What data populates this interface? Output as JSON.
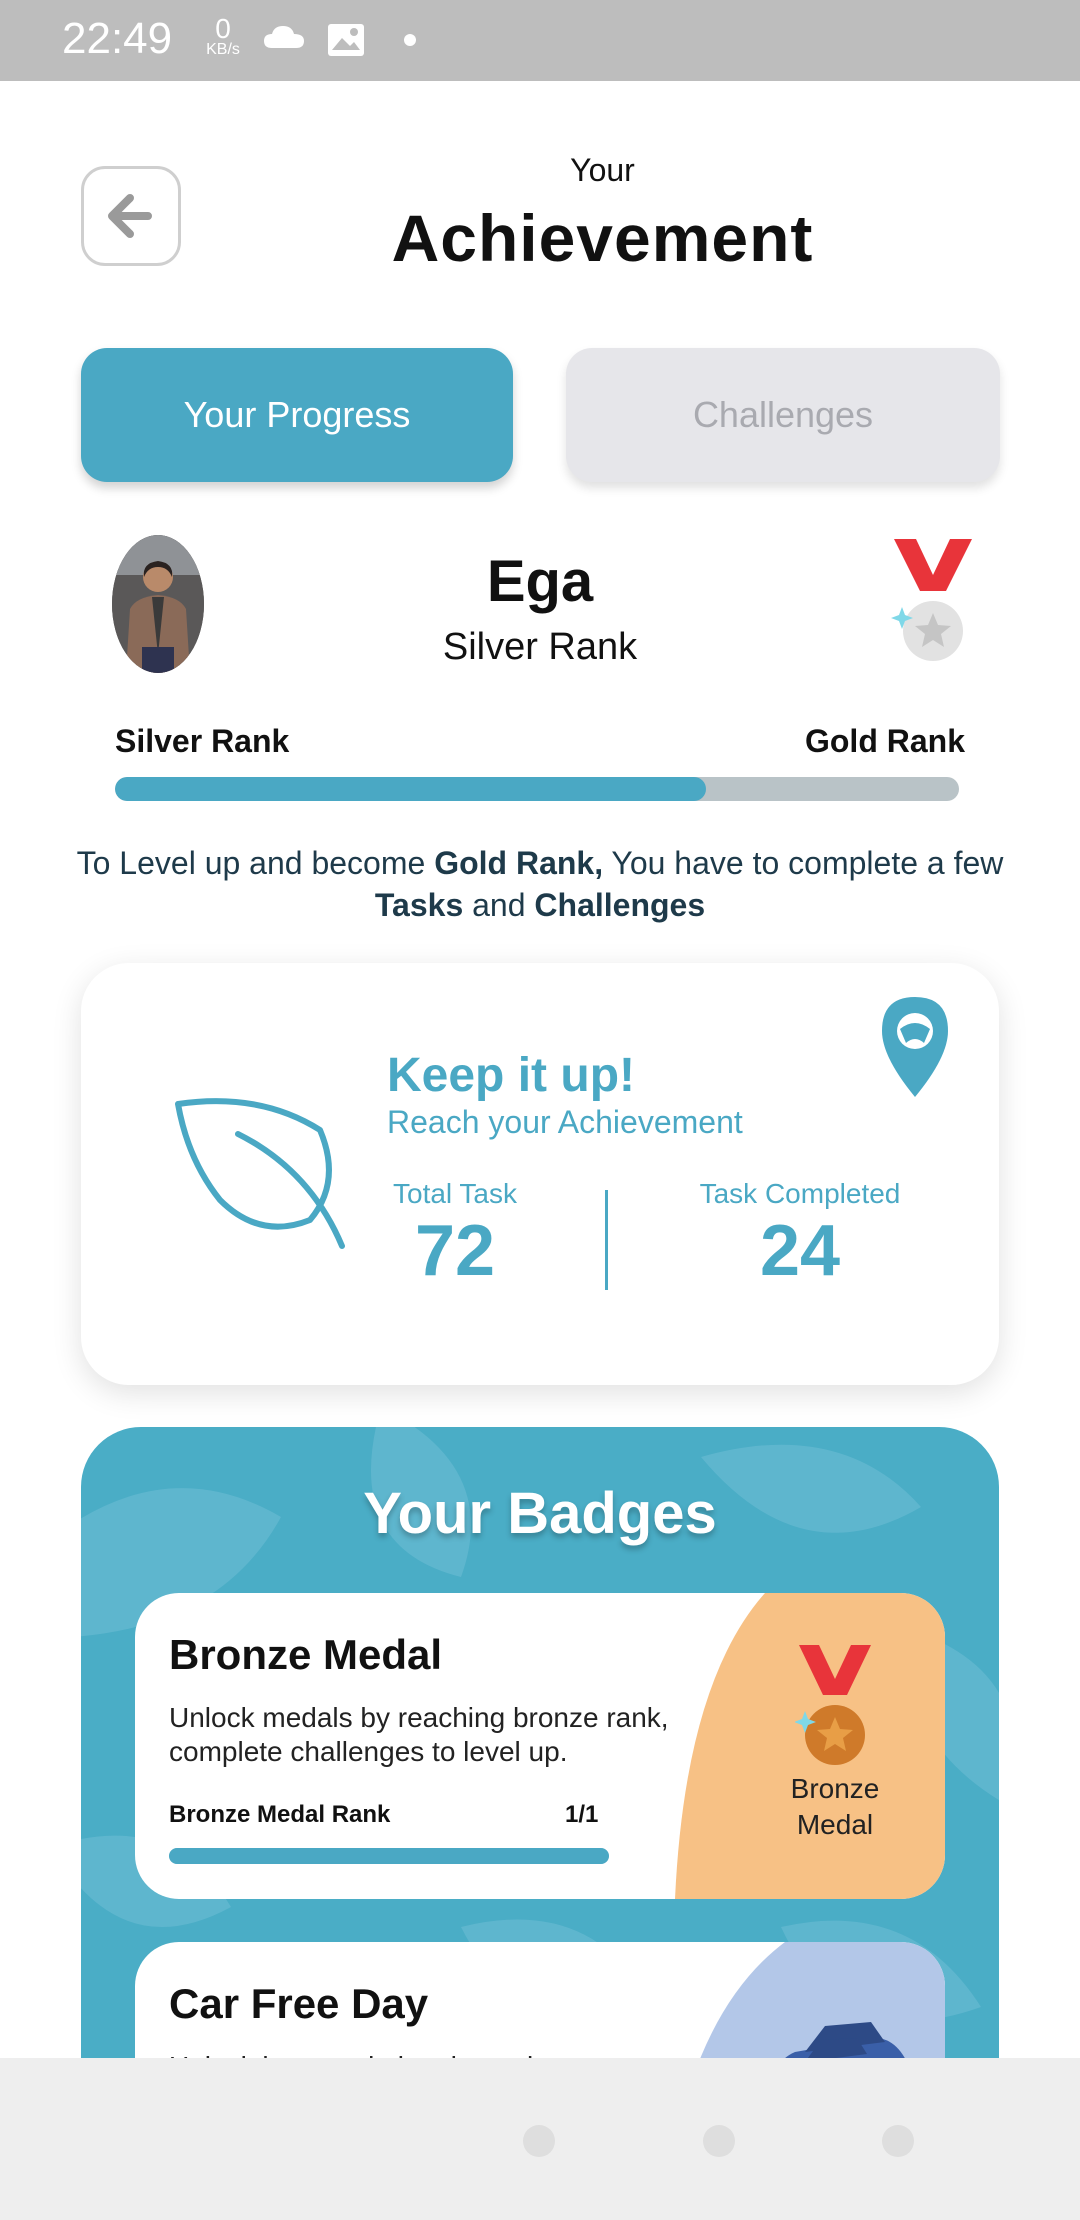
{
  "status_bar": {
    "time": "22:49",
    "net_speed": "0",
    "net_unit": "KB/s",
    "icons": [
      "cloud-icon",
      "image-icon",
      "dot-icon"
    ]
  },
  "header": {
    "subtitle": "Your",
    "title": "Achievement",
    "back_icon": "back-arrow-icon"
  },
  "tabs": [
    {
      "label": "Your Progress",
      "active": true
    },
    {
      "label": "Challenges",
      "active": false
    }
  ],
  "profile": {
    "name": "Ega",
    "rank": "Silver Rank",
    "current_rank_label": "Silver Rank",
    "next_rank_label": "Gold Rank",
    "progress_fraction": 0.7,
    "message_parts": [
      "To Level up and become ",
      "Gold Rank,",
      " You have to complete a few ",
      "Tasks",
      " and ",
      "Challenges"
    ]
  },
  "stats_card": {
    "heading": "Keep it up!",
    "subheading": "Reach your Achievement",
    "total_task_label": "Total Task",
    "total_task_value": "72",
    "completed_label": "Task Completed",
    "completed_value": "24"
  },
  "badges": {
    "title": "Your Badges",
    "items": [
      {
        "title": "Bronze Medal",
        "description": "Unlock medals by reaching bronze rank, complete challenges to level up.",
        "rank_label": "Bronze Medal Rank",
        "count": "1/1",
        "progress_fraction": 1.0,
        "medal_label_line1": "Bronze",
        "medal_label_line2": "Medal"
      },
      {
        "title": "Car Free Day",
        "description": "Unlock by completing the task"
      }
    ]
  },
  "colors": {
    "accent": "#4aa8c4",
    "bronze_bg": "#f7c185",
    "car_bg": "#b3c7e8",
    "medal_ribbon": "#e8343a"
  }
}
